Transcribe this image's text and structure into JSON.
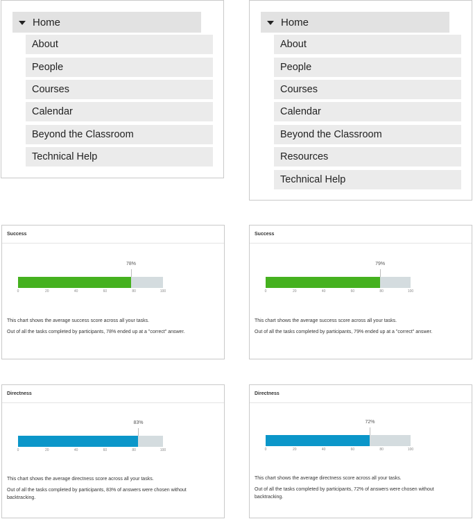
{
  "colors": {
    "success": "#45b11f",
    "directness": "#0b96c9",
    "track": "#d4dcdf"
  },
  "icons": {
    "expand": "caret-down-icon"
  },
  "nav_left": {
    "home": "Home",
    "items": [
      "About",
      "People",
      "Courses",
      "Calendar",
      "Beyond the Classroom",
      "Technical Help"
    ]
  },
  "nav_right": {
    "home": "Home",
    "items": [
      "About",
      "People",
      "Courses",
      "Calendar",
      "Beyond the Classroom",
      "Resources",
      "Technical Help"
    ]
  },
  "cards": {
    "success_left": {
      "title": "Success",
      "percent": 78,
      "percent_label": "78%",
      "ticks": [
        "0",
        "20",
        "40",
        "60",
        "80",
        "100"
      ],
      "desc1": "This chart shows the average success score across all your tasks.",
      "desc2": "Out of all the tasks completed by participants, 78% ended up at a \"correct\" answer."
    },
    "success_right": {
      "title": "Success",
      "percent": 79,
      "percent_label": "79%",
      "ticks": [
        "0",
        "20",
        "40",
        "60",
        "80",
        "100"
      ],
      "desc1": "This chart shows the average success score across all your tasks.",
      "desc2": "Out of all the tasks completed by participants, 79% ended up at a \"correct\" answer."
    },
    "directness_left": {
      "title": "Directness",
      "percent": 83,
      "percent_label": "83%",
      "ticks": [
        "0",
        "20",
        "40",
        "60",
        "80",
        "100"
      ],
      "desc1": "This chart shows the average directness score across all your tasks.",
      "desc2a": "Out of all the tasks completed by participants, 83% of answers were chosen without",
      "desc2b": "backtracking."
    },
    "directness_right": {
      "title": "Directness",
      "percent": 72,
      "percent_label": "72%",
      "ticks": [
        "0",
        "20",
        "40",
        "60",
        "80",
        "100"
      ],
      "desc1": "This chart shows the average directness score across all your tasks.",
      "desc2a": "Out of all the tasks completed by participants, 72% of answers were chosen without",
      "desc2b": "backtracking."
    }
  }
}
